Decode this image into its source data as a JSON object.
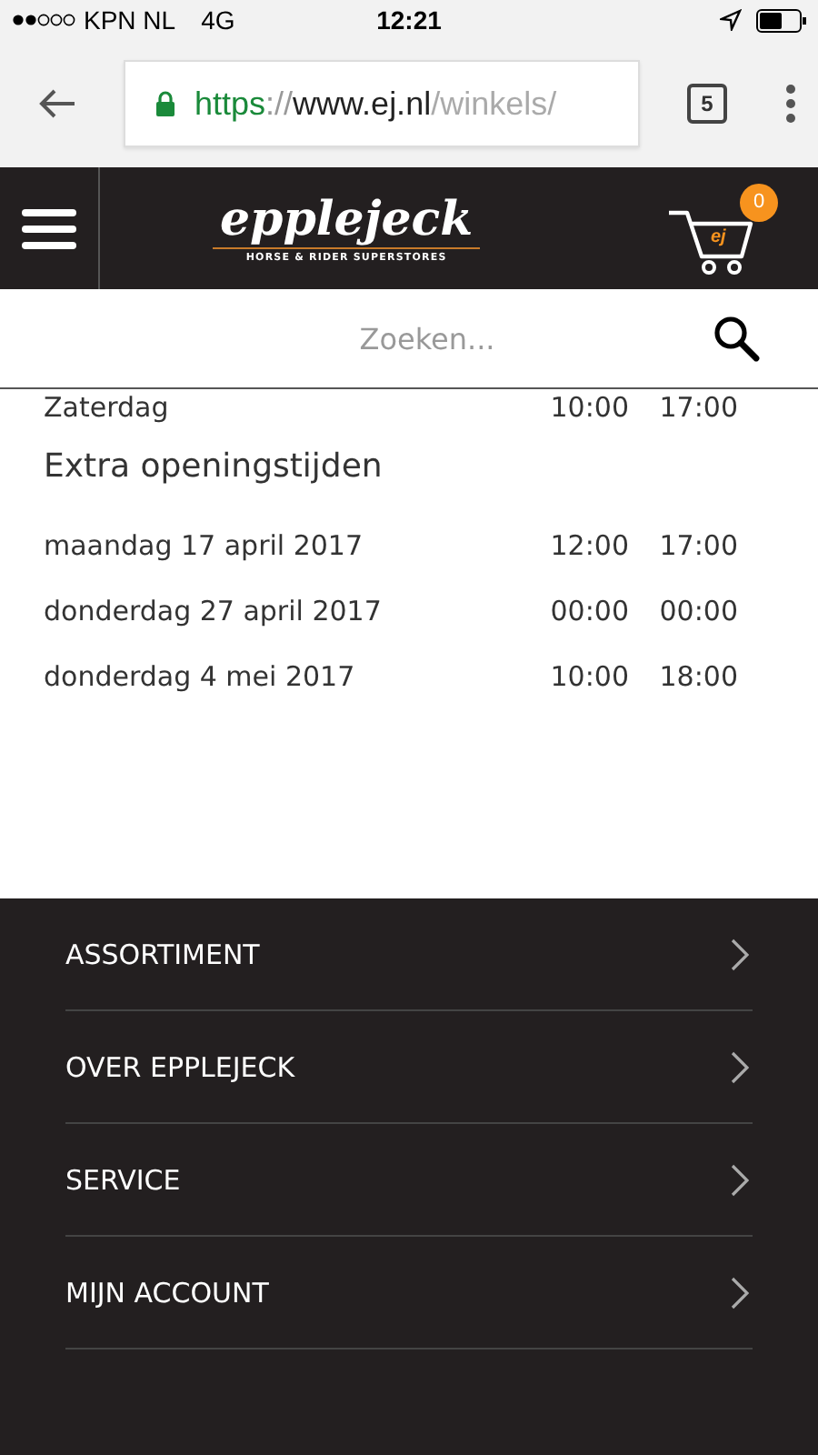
{
  "status_bar": {
    "carrier": "KPN NL",
    "network": "4G",
    "time": "12:21"
  },
  "browser": {
    "url_scheme": "https",
    "url_sep": "://",
    "url_host": "www.ej.nl",
    "url_path": "/winkels/",
    "tab_count": "5"
  },
  "header": {
    "logo": "epplejeck",
    "tagline": "HORSE & RIDER SUPERSTORES",
    "cart_badge": "0",
    "cart_logo": "ej"
  },
  "search": {
    "placeholder": "Zoeken..."
  },
  "hours": [
    {
      "day": "Zaterdag",
      "open": "10:00",
      "close": "17:00"
    }
  ],
  "extra": {
    "title": "Extra openingstijden",
    "rows": [
      {
        "day": "maandag 17 april 2017",
        "open": "12:00",
        "close": "17:00"
      },
      {
        "day": "donderdag 27 april 2017",
        "open": "00:00",
        "close": "00:00"
      },
      {
        "day": "donderdag 4 mei 2017",
        "open": "10:00",
        "close": "18:00"
      }
    ]
  },
  "footer_menu": [
    {
      "label": "ASSORTIMENT"
    },
    {
      "label": "OVER EPPLEJECK"
    },
    {
      "label": "SERVICE"
    },
    {
      "label": "MIJN ACCOUNT"
    }
  ]
}
